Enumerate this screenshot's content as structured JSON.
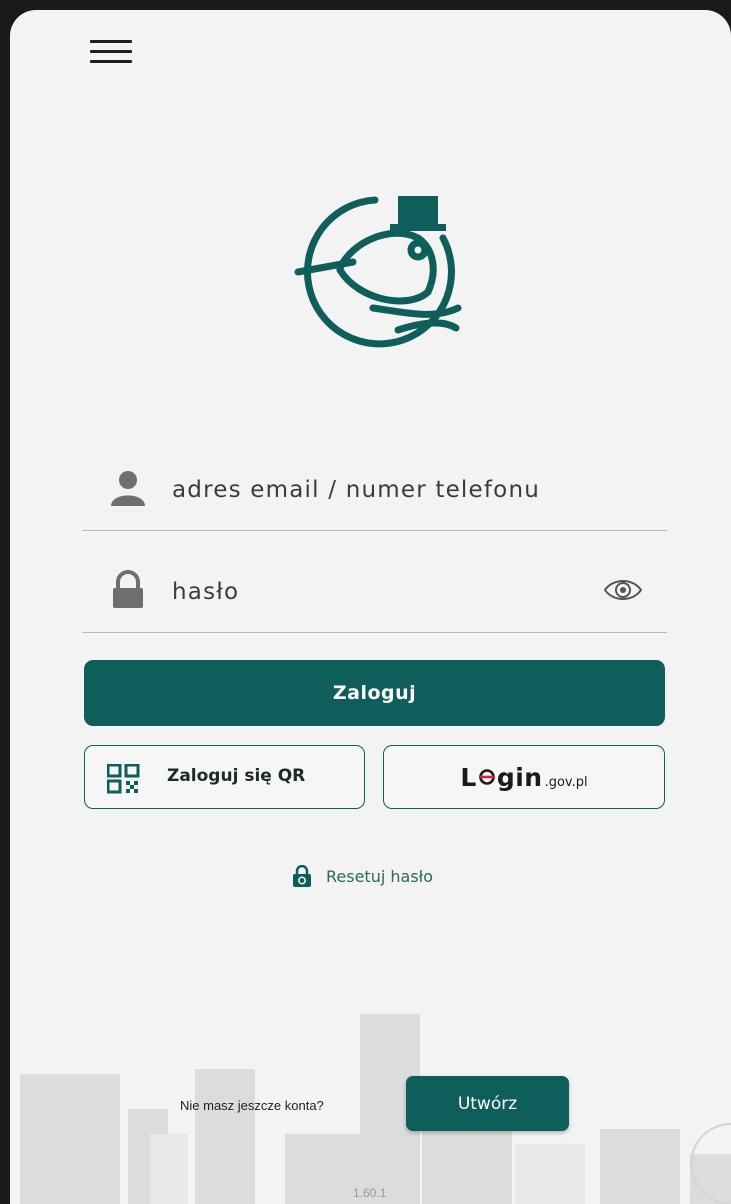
{
  "theme": {
    "accent": "#0e5e5b",
    "background": "#f3f3f3",
    "text": "#3b3b3b"
  },
  "header": {
    "menu_icon": "hamburger-menu-icon"
  },
  "logo": {
    "icon": "bird-with-top-hat-logo"
  },
  "form": {
    "email": {
      "icon": "user-icon",
      "placeholder": "adres email / numer telefonu"
    },
    "password": {
      "icon": "lock-icon",
      "placeholder": "hasło",
      "toggle_icon": "eye-icon"
    }
  },
  "buttons": {
    "login_label": "Zaloguj",
    "qr": {
      "icon": "qr-code-icon",
      "label": "Zaloguj się QR"
    },
    "gov": {
      "logo_big_1": "L",
      "logo_big_2": "gin",
      "logo_small": ".gov.pl"
    }
  },
  "reset": {
    "icon": "lock-reset-icon",
    "label": "Resetuj hasło"
  },
  "footer": {
    "no_account_text": "Nie masz jeszcze konta?",
    "create_label": "Utwórz",
    "version": "1.60.1"
  }
}
